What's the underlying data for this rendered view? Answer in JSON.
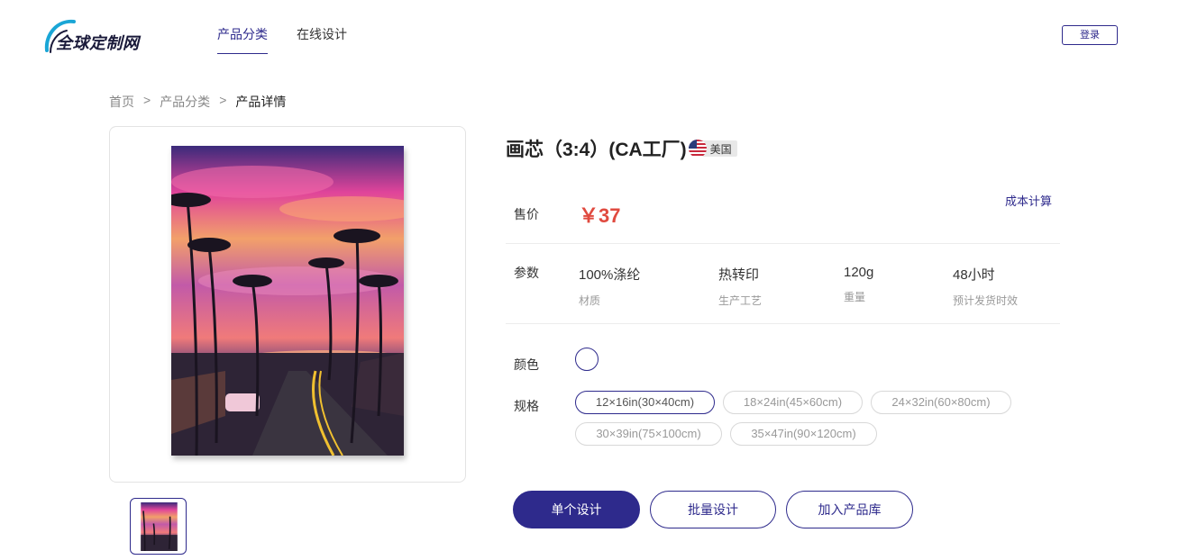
{
  "header": {
    "logo_text": "全球定制网",
    "nav": [
      {
        "label": "产品分类",
        "active": true
      },
      {
        "label": "在线设计",
        "active": false
      }
    ],
    "login_label": "登录"
  },
  "breadcrumb": {
    "items": [
      "首页",
      "产品分类",
      "产品详情"
    ],
    "separator": ">"
  },
  "product": {
    "title": "画芯（3:4）(CA工厂)",
    "country": "美国",
    "price_label": "售价",
    "price": "￥37",
    "cost_link": "成本计算",
    "params_label": "参数",
    "params": [
      {
        "value": "100%涤纶",
        "label": "材质"
      },
      {
        "value": "热转印",
        "label": "生产工艺"
      },
      {
        "value": "120g",
        "label": "重量"
      },
      {
        "value": "48小时",
        "label": "预计发货时效"
      }
    ],
    "color_label": "颜色",
    "size_label": "规格",
    "sizes": [
      {
        "label": "12×16in(30×40cm)",
        "selected": true
      },
      {
        "label": "18×24in(45×60cm)",
        "selected": false
      },
      {
        "label": "24×32in(60×80cm)",
        "selected": false
      },
      {
        "label": "30×39in(75×100cm)",
        "selected": false
      },
      {
        "label": "35×47in(90×120cm)",
        "selected": false
      }
    ]
  },
  "actions": {
    "single_design": "单个设计",
    "batch_design": "批量设计",
    "add_to_library": "加入产品库"
  },
  "colors": {
    "brand": "#2e2a8c",
    "price": "#e04a3f",
    "logo_arc": "#1aa6d6"
  }
}
